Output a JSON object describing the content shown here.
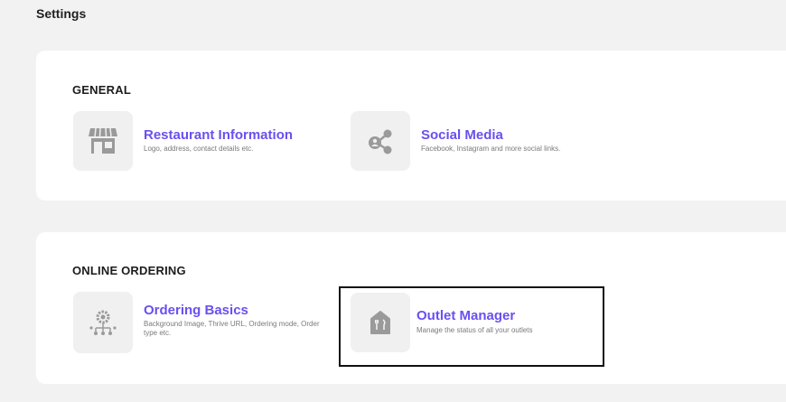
{
  "page": {
    "title": "Settings"
  },
  "sections": {
    "general": {
      "title": "GENERAL",
      "items": [
        {
          "title": "Restaurant Information",
          "description": "Logo, address, contact details etc.",
          "icon": "storefront-icon"
        },
        {
          "title": "Social Media",
          "description": "Facebook, Instagram and more social links.",
          "icon": "share-icon"
        }
      ]
    },
    "online_ordering": {
      "title": "ONLINE ORDERING",
      "items": [
        {
          "title": "Ordering Basics",
          "description": "Background Image, Thrive URL, Ordering mode, Order type etc.",
          "icon": "network-gear-icon"
        },
        {
          "title": "Outlet Manager",
          "description": "Manage the status of all your outlets",
          "icon": "outlet-home-icon"
        }
      ]
    }
  },
  "colors": {
    "accent": "#6a4ff0",
    "tile_bg": "#f0f0f0",
    "icon_gray": "#9a9a9a",
    "page_bg": "#f2f2f2",
    "card_bg": "#ffffff"
  }
}
